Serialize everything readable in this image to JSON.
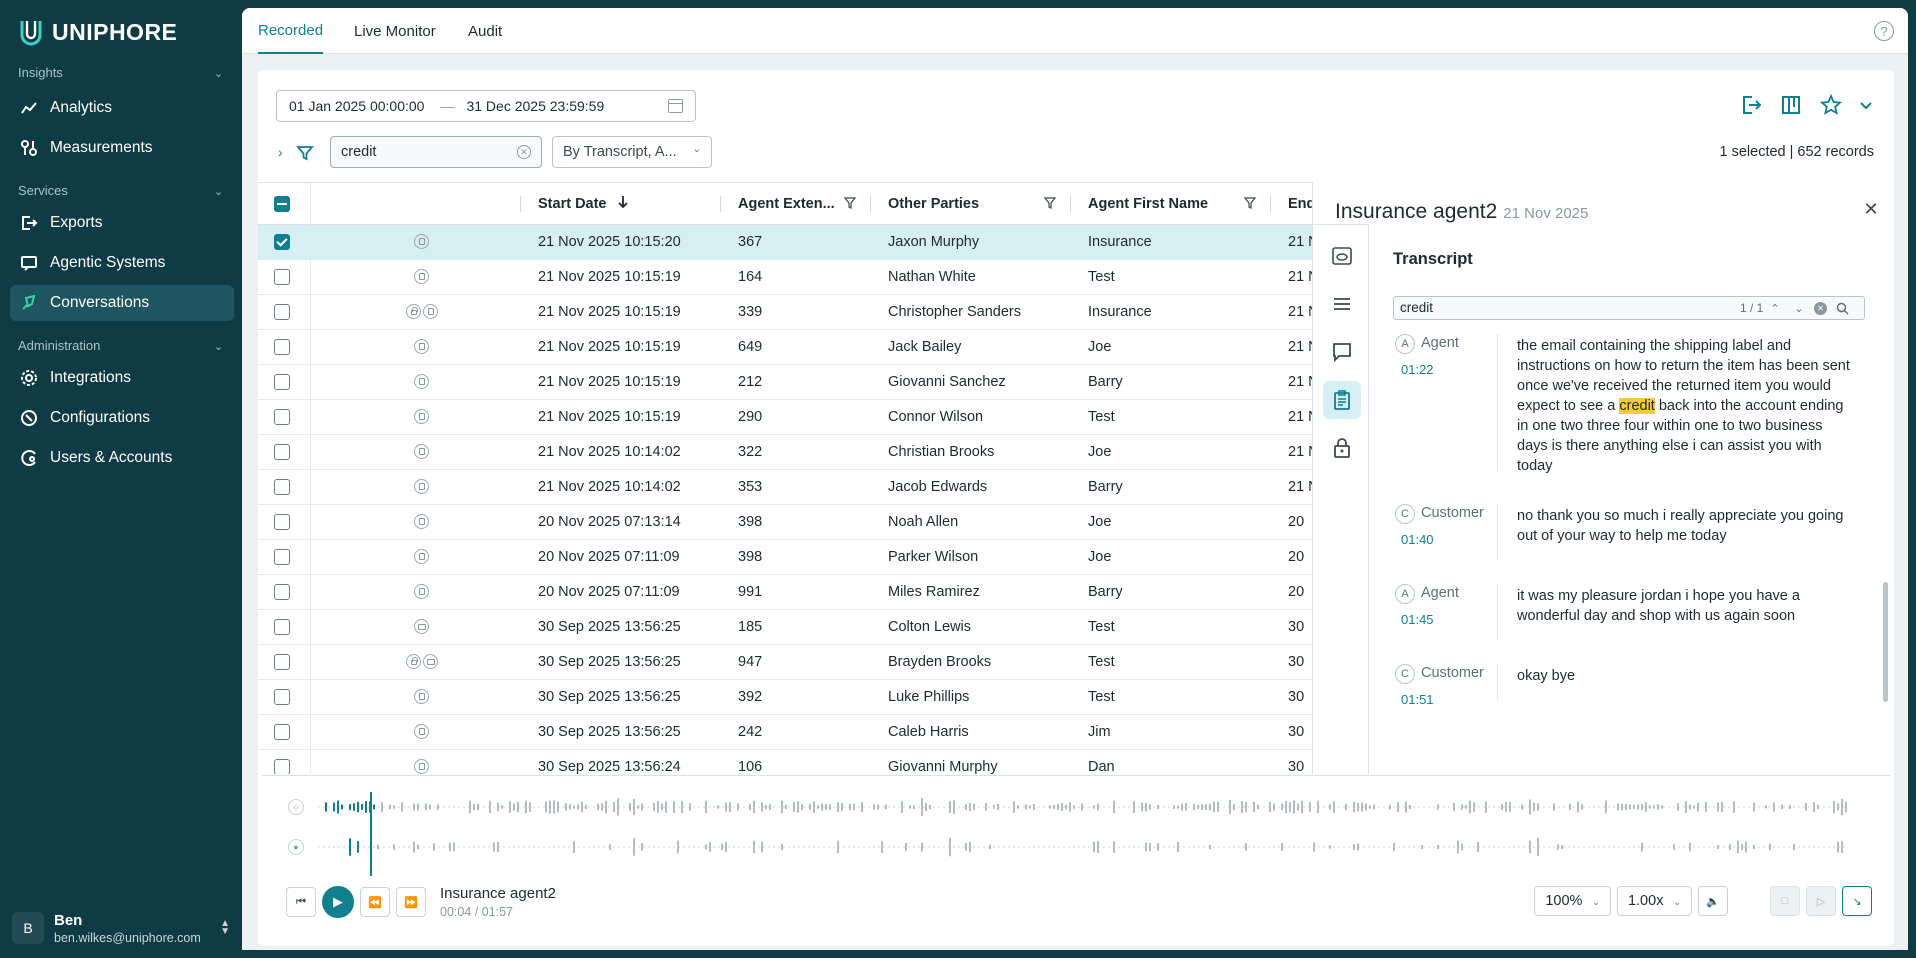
{
  "app": {
    "brand": "UNIPHORE"
  },
  "sidebar": {
    "sections": [
      {
        "label": "Insights",
        "items": [
          {
            "label": "Analytics",
            "icon": "analytics-icon"
          },
          {
            "label": "Measurements",
            "icon": "measurements-icon"
          }
        ]
      },
      {
        "label": "Services",
        "items": [
          {
            "label": "Exports",
            "icon": "exports-icon"
          },
          {
            "label": "Agentic Systems",
            "icon": "agentic-systems-icon"
          },
          {
            "label": "Conversations",
            "icon": "conversations-icon",
            "active": true
          }
        ]
      },
      {
        "label": "Administration",
        "items": [
          {
            "label": "Integrations",
            "icon": "integrations-icon"
          },
          {
            "label": "Configurations",
            "icon": "configurations-icon"
          },
          {
            "label": "Users & Accounts",
            "icon": "users-accounts-icon"
          }
        ]
      }
    ],
    "user": {
      "initial": "B",
      "name": "Ben",
      "email": "ben.wilkes@uniphore.com"
    }
  },
  "tabs": [
    {
      "label": "Recorded",
      "active": true
    },
    {
      "label": "Live Monitor"
    },
    {
      "label": "Audit"
    }
  ],
  "filters": {
    "date_from": "01 Jan 2025 00:00:00",
    "date_to": "31 Dec 2025 23:59:59",
    "date_sep": "—",
    "search_value": "credit",
    "scope": "By Transcript, A...",
    "records_info": "1 selected | 652 records"
  },
  "table": {
    "columns": [
      "Start Date",
      "Agent Exten...",
      "Other Parties",
      "Agent First Name",
      "End"
    ],
    "rows": [
      {
        "icons": [
          "doc"
        ],
        "start": "21 Nov 2025 10:15:20",
        "ext": "367",
        "other": "Jaxon Murphy",
        "agent": "Insurance",
        "end": "21 N",
        "selected": true
      },
      {
        "icons": [
          "doc"
        ],
        "start": "21 Nov 2025 10:15:19",
        "ext": "164",
        "other": "Nathan White",
        "agent": "Test",
        "end": "21 N"
      },
      {
        "icons": [
          "lock",
          "doc"
        ],
        "start": "21 Nov 2025 10:15:19",
        "ext": "339",
        "other": "Christopher Sanders",
        "agent": "Insurance",
        "end": "21 N"
      },
      {
        "icons": [
          "doc"
        ],
        "start": "21 Nov 2025 10:15:19",
        "ext": "649",
        "other": "Jack Bailey",
        "agent": "Joe",
        "end": "21 N"
      },
      {
        "icons": [
          "doc"
        ],
        "start": "21 Nov 2025 10:15:19",
        "ext": "212",
        "other": "Giovanni Sanchez",
        "agent": "Barry",
        "end": "21 N"
      },
      {
        "icons": [
          "doc"
        ],
        "start": "21 Nov 2025 10:15:19",
        "ext": "290",
        "other": "Connor Wilson",
        "agent": "Test",
        "end": "21 N"
      },
      {
        "icons": [
          "doc"
        ],
        "start": "21 Nov 2025 10:14:02",
        "ext": "322",
        "other": "Christian Brooks",
        "agent": "Joe",
        "end": "21 N"
      },
      {
        "icons": [
          "doc"
        ],
        "start": "21 Nov 2025 10:14:02",
        "ext": "353",
        "other": "Jacob Edwards",
        "agent": "Barry",
        "end": "21 N"
      },
      {
        "icons": [
          "doc"
        ],
        "start": "20 Nov 2025 07:13:14",
        "ext": "398",
        "other": "Noah Allen",
        "agent": "Joe",
        "end": "20"
      },
      {
        "icons": [
          "doc"
        ],
        "start": "20 Nov 2025 07:11:09",
        "ext": "398",
        "other": "Parker Wilson",
        "agent": "Joe",
        "end": "20"
      },
      {
        "icons": [
          "doc"
        ],
        "start": "20 Nov 2025 07:11:09",
        "ext": "991",
        "other": "Miles Ramirez",
        "agent": "Barry",
        "end": "20"
      },
      {
        "icons": [
          "chat"
        ],
        "start": "30 Sep 2025 13:56:25",
        "ext": "185",
        "other": "Colton Lewis",
        "agent": "Test",
        "end": "30"
      },
      {
        "icons": [
          "lock",
          "chat"
        ],
        "start": "30 Sep 2025 13:56:25",
        "ext": "947",
        "other": "Brayden Brooks",
        "agent": "Test",
        "end": "30"
      },
      {
        "icons": [
          "doc"
        ],
        "start": "30 Sep 2025 13:56:25",
        "ext": "392",
        "other": "Luke Phillips",
        "agent": "Test",
        "end": "30"
      },
      {
        "icons": [
          "doc"
        ],
        "start": "30 Sep 2025 13:56:25",
        "ext": "242",
        "other": "Caleb Harris",
        "agent": "Jim",
        "end": "30"
      },
      {
        "icons": [
          "doc"
        ],
        "start": "30 Sep 2025 13:56:24",
        "ext": "106",
        "other": "Giovanni Murphy",
        "agent": "Dan",
        "end": "30"
      }
    ]
  },
  "detail": {
    "title": "Insurance agent2",
    "date": "21 Nov 2025",
    "section_title": "Transcript",
    "search_value": "credit",
    "search_count": "1 / 1",
    "utterances": [
      {
        "initial": "A",
        "speaker": "Agent",
        "time": "01:22",
        "before": "the email containing the shipping label and instructions on how to return the item has been sent once we've received the returned item you would expect to see a ",
        "highlight": "credit",
        "after": " back into the account ending in one two three four within one to two business days is there anything else i can assist you with today"
      },
      {
        "initial": "C",
        "speaker": "Customer",
        "time": "01:40",
        "before": "no thank you so much i really appreciate you going out of your way to help me today",
        "highlight": "",
        "after": ""
      },
      {
        "initial": "A",
        "speaker": "Agent",
        "time": "01:45",
        "before": "it was my pleasure jordan i hope you have a wonderful day and shop with us again soon",
        "highlight": "",
        "after": ""
      },
      {
        "initial": "C",
        "speaker": "Customer",
        "time": "01:51",
        "before": "okay bye",
        "highlight": "",
        "after": ""
      }
    ]
  },
  "player": {
    "track_name": "Insurance agent2",
    "current_time": "00:04",
    "duration": "01:57",
    "zoom": "100%",
    "speed": "1.00x",
    "progress": 0.034
  },
  "colors": {
    "accent": "#127f8e",
    "sidebar_bg": "#0f3b45",
    "highlight": "#f7c93b"
  }
}
